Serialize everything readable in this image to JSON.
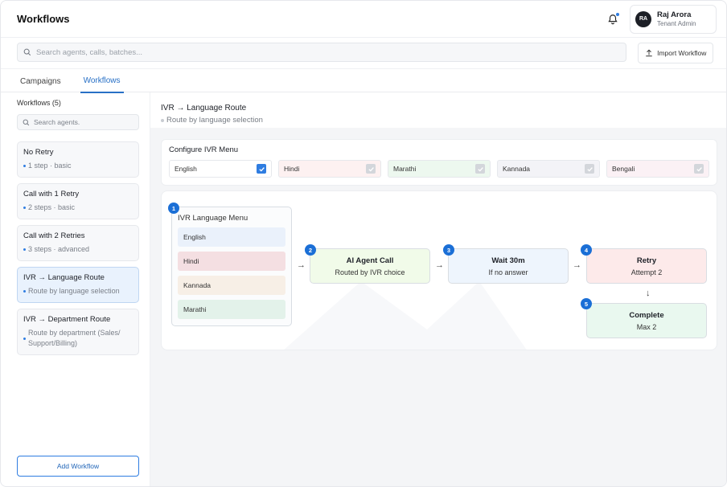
{
  "header": {
    "title": "Workflows",
    "user": {
      "initials": "RA",
      "name": "Raj Arora",
      "role": "Tenant Admin"
    }
  },
  "search": {
    "placeholder": "Search agents, calls, batches..."
  },
  "import_label": "Import Workflow",
  "tabs": [
    {
      "label": "Campaigns",
      "active": false
    },
    {
      "label": "Workflows",
      "active": true
    }
  ],
  "sidebar": {
    "title": "Workflows (5)",
    "search_placeholder": "Search agents.",
    "items": [
      {
        "name": "No Retry",
        "sub": "1 step · basic"
      },
      {
        "name": "Call with 1 Retry",
        "sub": "2 steps · basic"
      },
      {
        "name": "Call with 2 Retries",
        "sub": "3 steps · advanced"
      },
      {
        "name": "IVR → Language Route",
        "sub": "Route by language selection",
        "selected": true
      },
      {
        "name": "IVR → Department Route",
        "sub": "Route by department (Sales/ Support/Billing)"
      }
    ],
    "add_label": "Add Workflow"
  },
  "detail": {
    "title": "IVR → Language Route",
    "description": "Route by language selection"
  },
  "config": {
    "title": "Configure IVR Menu",
    "languages": [
      {
        "label": "English",
        "checked": true,
        "color": "#ffffff"
      },
      {
        "label": "Hindi",
        "checked": false,
        "color": "#fdf1f1"
      },
      {
        "label": "Marathi",
        "checked": false,
        "color": "#edf8ef"
      },
      {
        "label": "Kannada",
        "checked": false,
        "color": "#f3f3f7"
      },
      {
        "label": "Bengali",
        "checked": false,
        "color": "#fbf1f5"
      }
    ]
  },
  "flow": {
    "menu": {
      "badge": "1",
      "title": "IVR Language Menu",
      "options": [
        {
          "label": "English",
          "color": "#eaf1fb"
        },
        {
          "label": "Hindi",
          "color": "#f4dfe2"
        },
        {
          "label": "Kannada",
          "color": "#f7efe6"
        },
        {
          "label": "Marathi",
          "color": "#e3f2ea"
        }
      ]
    },
    "nodes": [
      {
        "badge": "2",
        "title": "AI Agent Call",
        "sub": "Routed by IVR choice",
        "color": "#f1fbe9"
      },
      {
        "badge": "3",
        "title": "Wait 30m",
        "sub": "If no answer",
        "color": "#eef5fd"
      },
      {
        "badge": "4",
        "title": "Retry",
        "sub": "Attempt 2",
        "color": "#fdeaea"
      },
      {
        "badge": "5",
        "title": "Complete",
        "sub": "Max 2",
        "color": "#e9f8ef"
      }
    ],
    "arrow_right": "→",
    "arrow_down": "↓"
  },
  "colors": {
    "accent": "#2f7de1",
    "badge": "#1b6fd6"
  }
}
